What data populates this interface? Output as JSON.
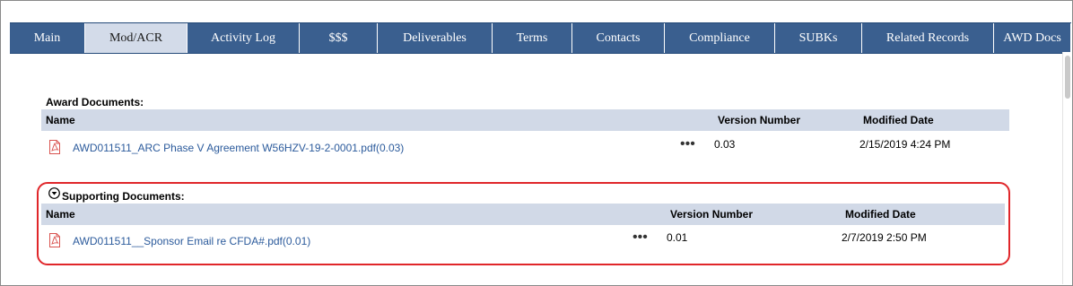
{
  "tabs": [
    {
      "label": "Main",
      "active": false
    },
    {
      "label": "Mod/ACR",
      "active": true
    },
    {
      "label": "Activity Log",
      "active": false
    },
    {
      "label": "$$$",
      "active": false
    },
    {
      "label": "Deliverables",
      "active": false
    },
    {
      "label": "Terms",
      "active": false
    },
    {
      "label": "Contacts",
      "active": false
    },
    {
      "label": "Compliance",
      "active": false
    },
    {
      "label": "SUBKs",
      "active": false
    },
    {
      "label": "Related Records",
      "active": false
    },
    {
      "label": "AWD Docs",
      "active": false
    }
  ],
  "award_documents": {
    "title": "Award Documents:",
    "columns": {
      "name": "Name",
      "version": "Version Number",
      "modified": "Modified Date"
    },
    "rows": [
      {
        "file": "AWD011511_ARC Phase V Agreement W56HZV-19-2-0001.pdf(0.03)",
        "more": "•••",
        "version": "0.03",
        "modified": "2/15/2019 4:24 PM"
      }
    ]
  },
  "supporting_documents": {
    "title": "Supporting Documents:",
    "columns": {
      "name": "Name",
      "version": "Version Number",
      "modified": "Modified Date"
    },
    "rows": [
      {
        "file": "AWD011511__Sponsor Email re CFDA#.pdf(0.01)",
        "more": "•••",
        "version": "0.01",
        "modified": "2/7/2019 2:50 PM"
      }
    ]
  },
  "colors": {
    "tab_bar": "#3a5f8f",
    "active_tab": "#d3dbe9",
    "table_header": "#d1d9e7",
    "link": "#2c5b9c",
    "pdf_icon": "#d9534f",
    "highlight": "#e0262a"
  },
  "icons": {
    "pdf": "pdf-file-icon",
    "toggle": "collapse-toggle-icon"
  }
}
